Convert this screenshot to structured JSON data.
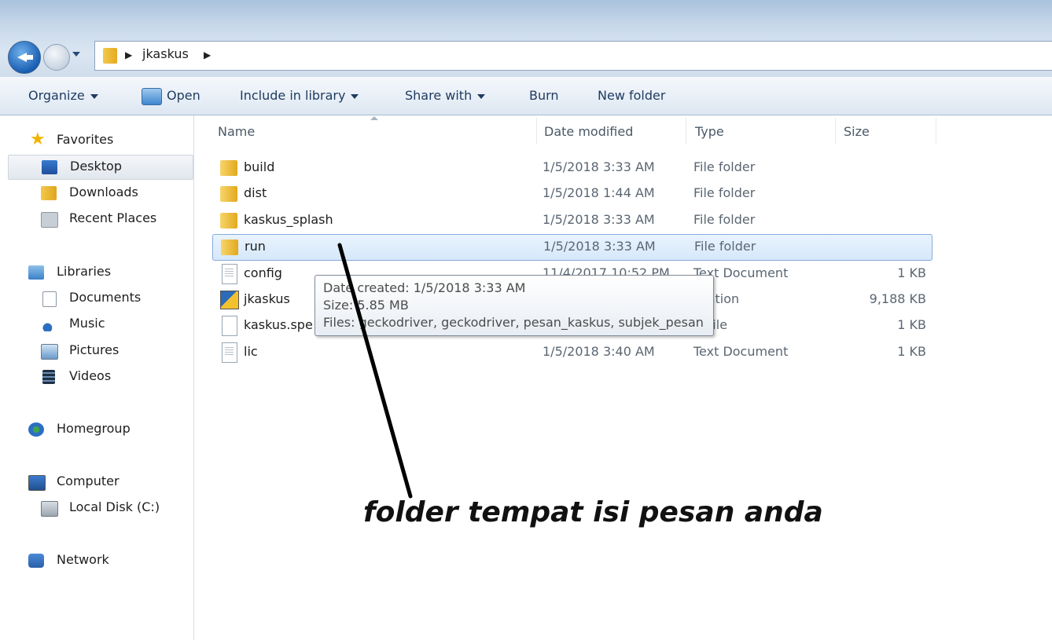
{
  "address": {
    "path": [
      "jkaskus"
    ]
  },
  "toolbar": {
    "organize": "Organize",
    "open": "Open",
    "include_in_library": "Include in library",
    "share_with": "Share with",
    "burn": "Burn",
    "new_folder": "New folder"
  },
  "nav": {
    "favorites": "Favorites",
    "desktop": "Desktop",
    "downloads": "Downloads",
    "recent_places": "Recent Places",
    "libraries": "Libraries",
    "documents": "Documents",
    "music": "Music",
    "pictures": "Pictures",
    "videos": "Videos",
    "homegroup": "Homegroup",
    "computer": "Computer",
    "local_disk": "Local Disk (C:)",
    "network": "Network"
  },
  "columns": {
    "name": "Name",
    "date": "Date modified",
    "type": "Type",
    "size": "Size"
  },
  "files": [
    {
      "name": "build",
      "date": "1/5/2018 3:33 AM",
      "type": "File folder",
      "size": ""
    },
    {
      "name": "dist",
      "date": "1/5/2018 1:44 AM",
      "type": "File folder",
      "size": ""
    },
    {
      "name": "kaskus_splash",
      "date": "1/5/2018 3:33 AM",
      "type": "File folder",
      "size": ""
    },
    {
      "name": "run",
      "date": "1/5/2018 3:33 AM",
      "type": "File folder",
      "size": ""
    },
    {
      "name": "config",
      "date": "11/4/2017 10:52 PM",
      "type": "Text Document",
      "size": "1 KB"
    },
    {
      "name": "jkaskus",
      "date": "",
      "type": "lication",
      "size": "9,188 KB"
    },
    {
      "name": "kaskus.spe",
      "date": "",
      "type": "C File",
      "size": "1 KB"
    },
    {
      "name": "lic",
      "date": "1/5/2018 3:40 AM",
      "type": "Text Document",
      "size": "1 KB"
    }
  ],
  "tooltip": {
    "created": "Date created: 1/5/2018 3:33 AM",
    "size": "Size: 5.85 MB",
    "files": "Files: geckodriver, geckodriver, pesan_kaskus, subjek_pesan"
  },
  "annotation": "folder tempat isi pesan anda"
}
